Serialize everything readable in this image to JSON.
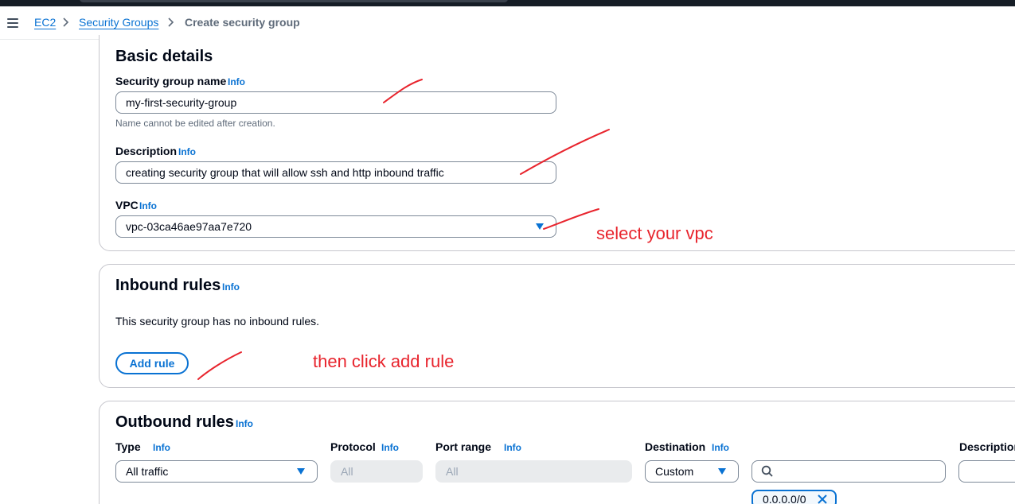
{
  "breadcrumb": {
    "items": [
      {
        "label": "EC2"
      },
      {
        "label": "Security Groups"
      },
      {
        "label": "Create security group"
      }
    ]
  },
  "basic_details": {
    "title": "Basic details",
    "name_label": "Security group name",
    "name_info": "Info",
    "name_value": "my-first-security-group",
    "name_hint": "Name cannot be edited after creation.",
    "description_label": "Description",
    "description_info": "Info",
    "description_value": "creating security group that will allow ssh and http inbound traffic",
    "vpc_label": "VPC",
    "vpc_info": "Info",
    "vpc_value": "vpc-03ca46ae97aa7e720"
  },
  "inbound_rules": {
    "title": "Inbound rules",
    "info": "Info",
    "empty_text": "This security group has no inbound rules.",
    "add_rule_label": "Add rule"
  },
  "outbound_rules": {
    "title": "Outbound rules",
    "info": "Info",
    "columns": {
      "type": "Type",
      "protocol": "Protocol",
      "port_range": "Port range",
      "destination": "Destination",
      "description": "Description",
      "info": "Info"
    },
    "row": {
      "type_value": "All traffic",
      "protocol_value": "All",
      "port_range_value": "All",
      "destination_value": "Custom",
      "search_placeholder": "",
      "cidr_token": "0.0.0.0/0"
    }
  },
  "annotations": {
    "vpc_note": "select your vpc",
    "add_rule_note": "then click add rule",
    "color": "#e8242d"
  },
  "colors": {
    "link": "#0972d3",
    "text": "#000716",
    "border": "#7d8998",
    "disabled_bg": "#e9ebed"
  }
}
